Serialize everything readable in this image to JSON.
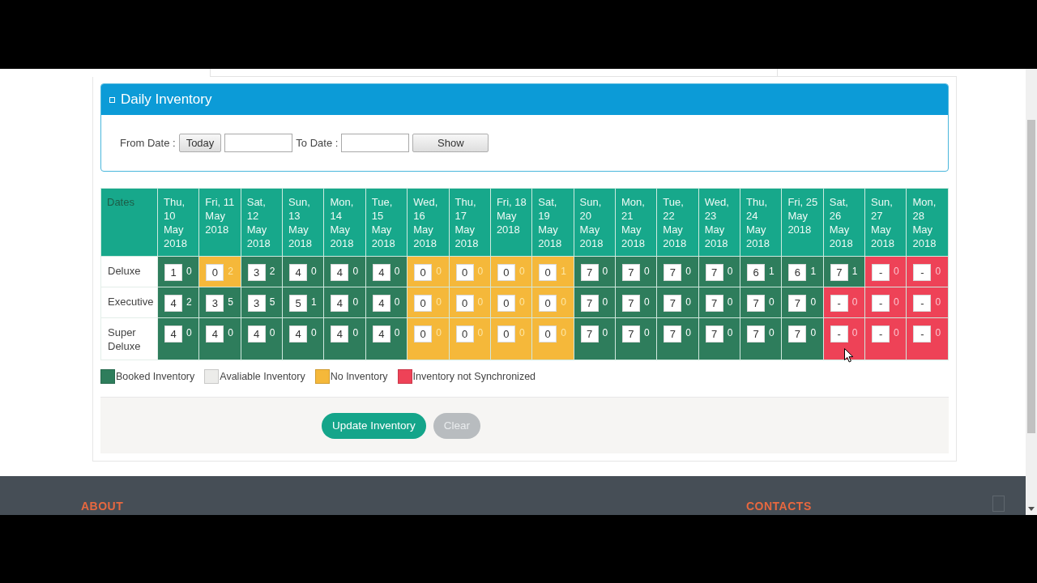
{
  "panel": {
    "title": "Daily Inventory"
  },
  "filter": {
    "from_label": "From Date :",
    "today_button": "Today",
    "to_label": "To Date :",
    "show_button": "Show"
  },
  "table": {
    "corner": "Dates",
    "columns": [
      "Thu, 10 May 2018",
      "Fri, 11 May 2018",
      "Sat, 12 May 2018",
      "Sun, 13 May 2018",
      "Mon, 14 May 2018",
      "Tue, 15 May 2018",
      "Wed, 16 May 2018",
      "Thu, 17 May 2018",
      "Fri, 18 May 2018",
      "Sat, 19 May 2018",
      "Sun, 20 May 2018",
      "Mon, 21 May 2018",
      "Tue, 22 May 2018",
      "Wed, 23 May 2018",
      "Thu, 24 May 2018",
      "Fri, 25 May 2018",
      "Sat, 26 May 2018",
      "Sun, 27 May 2018",
      "Mon, 28 May 2018"
    ],
    "rows": [
      {
        "room": "Deluxe",
        "cells": [
          {
            "kind": "booked",
            "value": "1",
            "count": "0"
          },
          {
            "kind": "none",
            "value": "0",
            "count": "2"
          },
          {
            "kind": "booked",
            "value": "3",
            "count": "2"
          },
          {
            "kind": "booked",
            "value": "4",
            "count": "0"
          },
          {
            "kind": "booked",
            "value": "4",
            "count": "0"
          },
          {
            "kind": "booked",
            "value": "4",
            "count": "0"
          },
          {
            "kind": "none",
            "value": "0",
            "count": "0"
          },
          {
            "kind": "none",
            "value": "0",
            "count": "0"
          },
          {
            "kind": "none",
            "value": "0",
            "count": "0"
          },
          {
            "kind": "none",
            "value": "0",
            "count": "1"
          },
          {
            "kind": "booked",
            "value": "7",
            "count": "0"
          },
          {
            "kind": "booked",
            "value": "7",
            "count": "0"
          },
          {
            "kind": "booked",
            "value": "7",
            "count": "0"
          },
          {
            "kind": "booked",
            "value": "7",
            "count": "0"
          },
          {
            "kind": "booked",
            "value": "6",
            "count": "1"
          },
          {
            "kind": "booked",
            "value": "6",
            "count": "1"
          },
          {
            "kind": "booked",
            "value": "7",
            "count": "1"
          },
          {
            "kind": "unsynced",
            "value": "-",
            "count": "0"
          },
          {
            "kind": "unsynced",
            "value": "-",
            "count": "0"
          }
        ]
      },
      {
        "room": "Executive",
        "cells": [
          {
            "kind": "booked",
            "value": "4",
            "count": "2"
          },
          {
            "kind": "booked",
            "value": "3",
            "count": "5"
          },
          {
            "kind": "booked",
            "value": "3",
            "count": "5"
          },
          {
            "kind": "booked",
            "value": "5",
            "count": "1"
          },
          {
            "kind": "booked",
            "value": "4",
            "count": "0"
          },
          {
            "kind": "booked",
            "value": "4",
            "count": "0"
          },
          {
            "kind": "none",
            "value": "0",
            "count": "0"
          },
          {
            "kind": "none",
            "value": "0",
            "count": "0"
          },
          {
            "kind": "none",
            "value": "0",
            "count": "0"
          },
          {
            "kind": "none",
            "value": "0",
            "count": "0"
          },
          {
            "kind": "booked",
            "value": "7",
            "count": "0"
          },
          {
            "kind": "booked",
            "value": "7",
            "count": "0"
          },
          {
            "kind": "booked",
            "value": "7",
            "count": "0"
          },
          {
            "kind": "booked",
            "value": "7",
            "count": "0"
          },
          {
            "kind": "booked",
            "value": "7",
            "count": "0"
          },
          {
            "kind": "booked",
            "value": "7",
            "count": "0"
          },
          {
            "kind": "unsynced",
            "value": "-",
            "count": "0"
          },
          {
            "kind": "unsynced",
            "value": "-",
            "count": "0"
          },
          {
            "kind": "unsynced",
            "value": "-",
            "count": "0"
          }
        ]
      },
      {
        "room": "Super Deluxe",
        "cells": [
          {
            "kind": "booked",
            "value": "4",
            "count": "0"
          },
          {
            "kind": "booked",
            "value": "4",
            "count": "0"
          },
          {
            "kind": "booked",
            "value": "4",
            "count": "0"
          },
          {
            "kind": "booked",
            "value": "4",
            "count": "0"
          },
          {
            "kind": "booked",
            "value": "4",
            "count": "0"
          },
          {
            "kind": "booked",
            "value": "4",
            "count": "0"
          },
          {
            "kind": "none",
            "value": "0",
            "count": "0"
          },
          {
            "kind": "none",
            "value": "0",
            "count": "0"
          },
          {
            "kind": "none",
            "value": "0",
            "count": "0"
          },
          {
            "kind": "none",
            "value": "0",
            "count": "0"
          },
          {
            "kind": "booked",
            "value": "7",
            "count": "0"
          },
          {
            "kind": "booked",
            "value": "7",
            "count": "0"
          },
          {
            "kind": "booked",
            "value": "7",
            "count": "0"
          },
          {
            "kind": "booked",
            "value": "7",
            "count": "0"
          },
          {
            "kind": "booked",
            "value": "7",
            "count": "0"
          },
          {
            "kind": "booked",
            "value": "7",
            "count": "0"
          },
          {
            "kind": "unsynced",
            "value": "-",
            "count": "0"
          },
          {
            "kind": "unsynced",
            "value": "-",
            "count": "0"
          },
          {
            "kind": "unsynced",
            "value": "-",
            "count": "0"
          }
        ]
      }
    ]
  },
  "legend": [
    {
      "kind": "booked",
      "label": "Booked Inventory",
      "color": "#2e7d5c"
    },
    {
      "kind": "available",
      "label": "Avaliable Inventory",
      "color": "#ececea"
    },
    {
      "kind": "none",
      "label": "No Inventory",
      "color": "#f5b83a"
    },
    {
      "kind": "unsynced",
      "label": "Inventory not Synchronized",
      "color": "#ee4257"
    }
  ],
  "actions": [
    {
      "label": "Update Inventory",
      "disabled": false
    },
    {
      "label": "Clear",
      "disabled": true
    }
  ],
  "footer": {
    "headings": [
      "ABOUT",
      "CONTACTS"
    ]
  }
}
